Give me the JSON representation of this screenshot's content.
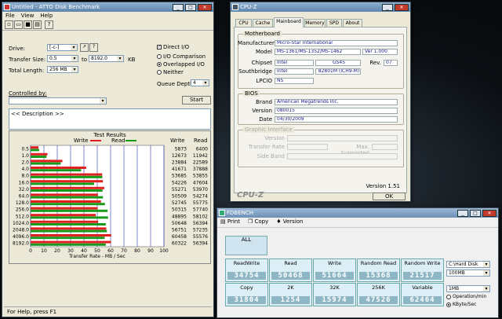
{
  "atto": {
    "title": "Untitled - ATTO Disk Benchmark",
    "menu": [
      "File",
      "View",
      "Help"
    ],
    "drive_label": "Drive:",
    "drive_value": "[-c-]",
    "transfer_label": "Transfer Size:",
    "transfer_from": "0.5",
    "to_label": "to",
    "transfer_to": "8192.0",
    "kb_label": "KB",
    "length_label": "Total Length:",
    "length_value": "256 MB",
    "direct_io": "Direct I/O",
    "io_comparison": "I/O Comparison",
    "overlapped_io": "Overlapped I/O",
    "neither": "Neither",
    "queue_label": "Queue Depth:",
    "queue_value": "4",
    "controlled_label": "Controlled by:",
    "start_label": "Start",
    "description": "<< Description >>",
    "results_title": "Test Results",
    "write_legend": "Write",
    "read_legend": "Read",
    "col_write": "Write",
    "col_read": "Read",
    "status": "For Help, press F1",
    "colors": {
      "write": "#e02020",
      "read": "#1a9a1a"
    }
  },
  "chart_data": {
    "type": "bar",
    "title": "Test Results",
    "xlabel": "Transfer Rate - MB / Sec",
    "xlim": [
      0,
      100
    ],
    "xticks": [
      "0",
      "10",
      "20",
      "30",
      "40",
      "50",
      "60",
      "70",
      "80",
      "90",
      "100"
    ],
    "categories": [
      "0.5",
      "1.0",
      "2.0",
      "4.0",
      "8.0",
      "16.0",
      "32.0",
      "64.0",
      "128.0",
      "256.0",
      "512.0",
      "1024.0",
      "2048.0",
      "4096.0",
      "8192.0"
    ],
    "series": [
      {
        "name": "Write",
        "values": [
          5.873,
          12.673,
          23.884,
          41.671,
          53.685,
          54.226,
          55.271,
          50.509,
          52.745,
          50.315,
          48.895,
          50.648,
          56.751,
          60.458,
          60.322
        ]
      },
      {
        "name": "Read",
        "values": [
          6.4,
          11.942,
          22.589,
          37.888,
          53.855,
          47.604,
          53.97,
          54.274,
          55.775,
          57.74,
          58.102,
          56.394,
          57.235,
          55.576,
          56.394
        ]
      }
    ],
    "write_text": [
      "5873",
      "12673",
      "23884",
      "41671",
      "53685",
      "54226",
      "55271",
      "50509",
      "52745",
      "50315",
      "48895",
      "50648",
      "56751",
      "60458",
      "60322"
    ],
    "read_text": [
      "6400",
      "11942",
      "22589",
      "37888",
      "53855",
      "47604",
      "53970",
      "54274",
      "55775",
      "57740",
      "58102",
      "56394",
      "57235",
      "55576",
      "56394"
    ]
  },
  "cpuz": {
    "title": "CPU-Z",
    "tabs": [
      "CPU",
      "Cache",
      "Mainboard",
      "Memory",
      "SPD",
      "About"
    ],
    "motherboard_group": "Motherboard",
    "manufacturer_label": "Manufacturer",
    "manufacturer": "Micro-Star International",
    "model_label": "Model",
    "model": "MS-1361/MS-1352/MS-1462",
    "model_ver": "Ver 1.000",
    "chipset_label": "Chipset",
    "chipset_vendor": "Intel",
    "chipset": "GS45",
    "rev_label": "Rev.",
    "chipset_rev": "07",
    "southbridge_label": "Southbridge",
    "sb_vendor": "Intel",
    "southbridge": "82801M (ICH9-M)",
    "lpcio_label": "LPCIO",
    "lpcio": "NS",
    "bios_group": "BIOS",
    "brand_label": "Brand",
    "brand": "American Megatrends Inc.",
    "version_label": "Version",
    "bios_version": "080015",
    "date_label": "Date",
    "bios_date": "04/30/2009",
    "gi_group": "Graphic Interface",
    "gi_version_label": "Version",
    "gi_rate_label": "Transfer Rate",
    "gi_max_label": "Max. Supported",
    "gi_band_label": "Side Band",
    "logo": "CPU-Z",
    "app_version": "Version 1.51",
    "ok_label": "OK"
  },
  "fdbench": {
    "title": "FDBENCH",
    "toolbar": [
      "Print",
      "Copy",
      "Version"
    ],
    "all_label": "ALL",
    "row1": [
      {
        "label": "ReadWrite",
        "value": "34754"
      },
      {
        "label": "Read",
        "value": "50468"
      },
      {
        "label": "Write",
        "value": "51664"
      },
      {
        "label": "Random Read",
        "value": "15368"
      },
      {
        "label": "Random Write",
        "value": "21517"
      }
    ],
    "row2": [
      {
        "label": "Copy",
        "value": "31804"
      },
      {
        "label": "2K",
        "value": "1254"
      },
      {
        "label": "32K",
        "value": "15974"
      },
      {
        "label": "256K",
        "value": "47526"
      },
      {
        "label": "Variable",
        "value": "62464"
      }
    ],
    "drive_select": "C:\\Hard Disk",
    "size_select": "100MB",
    "block_select": "1MB",
    "opt_ops": "Operation/min",
    "opt_kbs": "KByte/Sec"
  }
}
